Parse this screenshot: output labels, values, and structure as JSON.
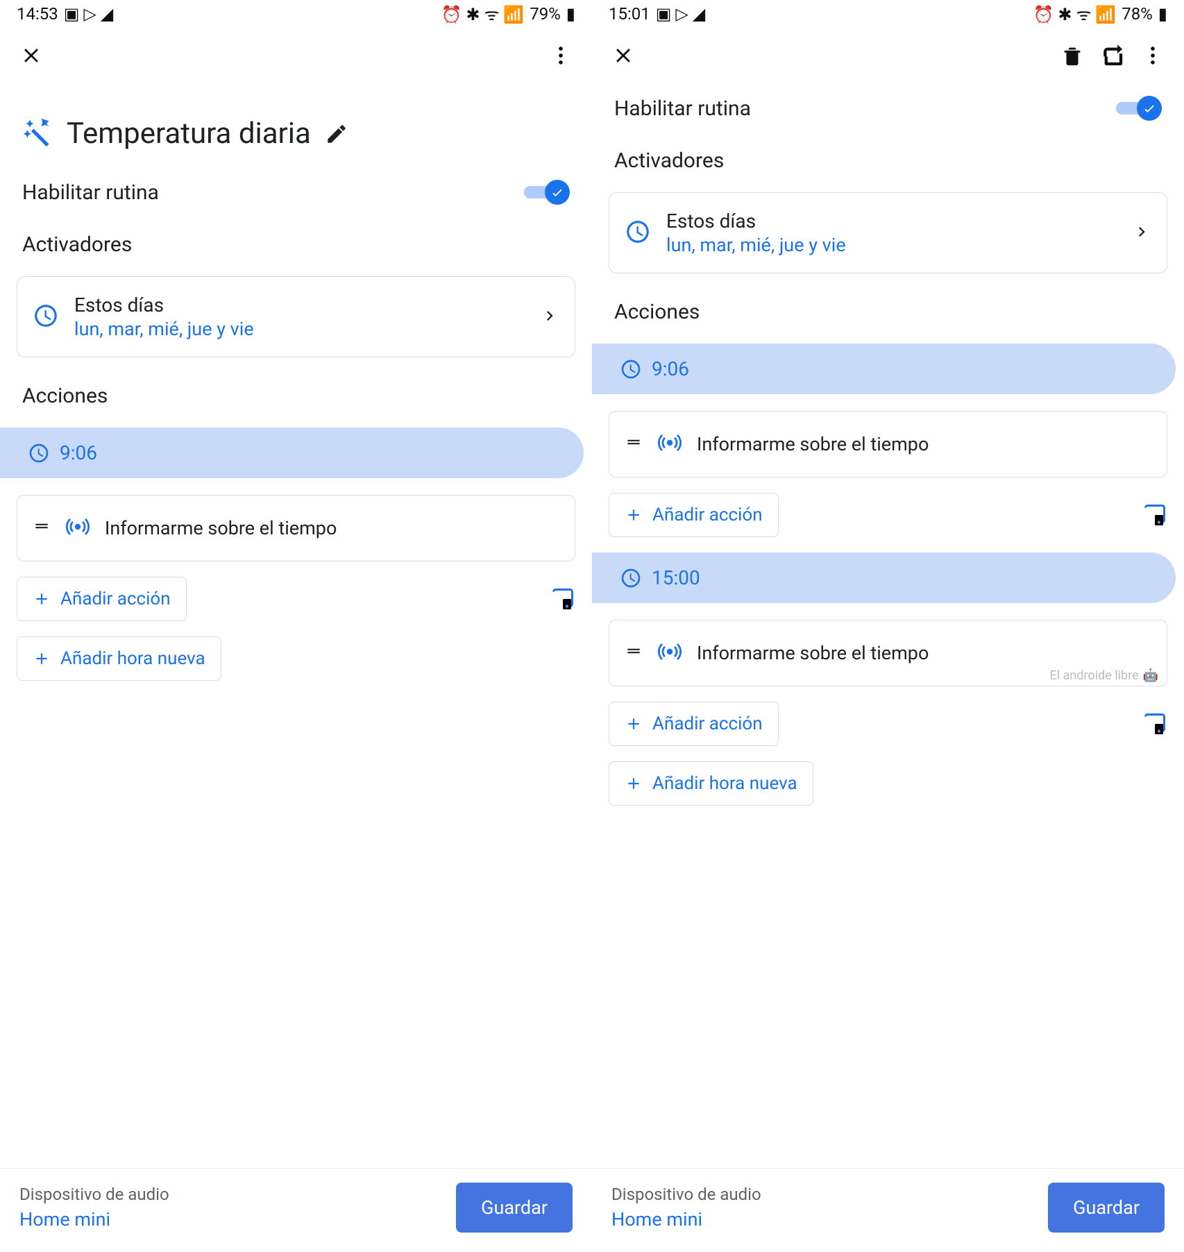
{
  "left": {
    "status": {
      "time": "14:53",
      "battery": "79%"
    },
    "title": "Temperatura diaria",
    "enable_label": "Habilitar rutina",
    "activators_label": "Activadores",
    "days_card": {
      "title": "Estos días",
      "sub": "lun, mar, mié, jue y vie"
    },
    "actions_label": "Acciones",
    "time1": "9:06",
    "action1": "Informarme sobre el tiempo",
    "add_action": "Añadir acción",
    "add_time": "Añadir hora nueva",
    "footer": {
      "label": "Dispositivo de audio",
      "device": "Home mini",
      "save": "Guardar"
    }
  },
  "right": {
    "status": {
      "time": "15:01",
      "battery": "78%"
    },
    "enable_label": "Habilitar rutina",
    "activators_label": "Activadores",
    "days_card": {
      "title": "Estos días",
      "sub": "lun, mar, mié, jue y vie"
    },
    "actions_label": "Acciones",
    "time1": "9:06",
    "action1": "Informarme sobre el tiempo",
    "add_action1": "Añadir acción",
    "time2": "15:00",
    "action2": "Informarme sobre el tiempo",
    "watermark": "El androide libre",
    "add_action2": "Añadir acción",
    "add_time": "Añadir hora nueva",
    "footer": {
      "label": "Dispositivo de audio",
      "device": "Home mini",
      "save": "Guardar"
    }
  }
}
